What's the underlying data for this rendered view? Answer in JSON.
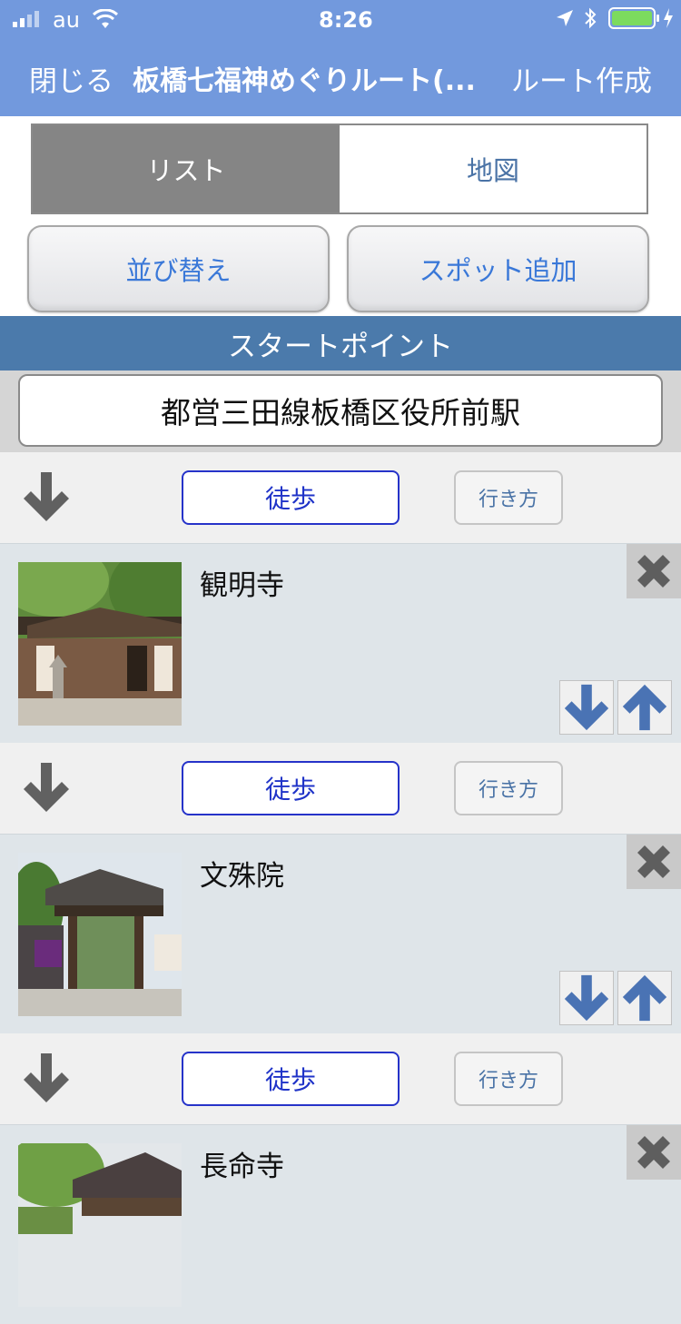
{
  "status_bar": {
    "carrier": "au",
    "time": "8:26"
  },
  "nav": {
    "close_label": "閉じる",
    "title": "板橋七福神めぐりルート(...",
    "create_label": "ルート作成"
  },
  "segments": {
    "list_label": "リスト",
    "map_label": "地図",
    "active": "list"
  },
  "actions": {
    "sort_label": "並び替え",
    "add_spot_label": "スポット追加"
  },
  "start": {
    "header": "スタートポイント",
    "point": "都営三田線板橋区役所前駅"
  },
  "walk": {
    "mode_label": "徒歩",
    "directions_label": "行き方"
  },
  "spots": [
    {
      "name": "観明寺"
    },
    {
      "name": "文殊院"
    },
    {
      "name": "長命寺"
    }
  ],
  "colors": {
    "nav_bar": "#7299dd",
    "section_header": "#4b7aab",
    "accent_button": "#1f33c8",
    "move_arrow": "#4a73b4"
  }
}
